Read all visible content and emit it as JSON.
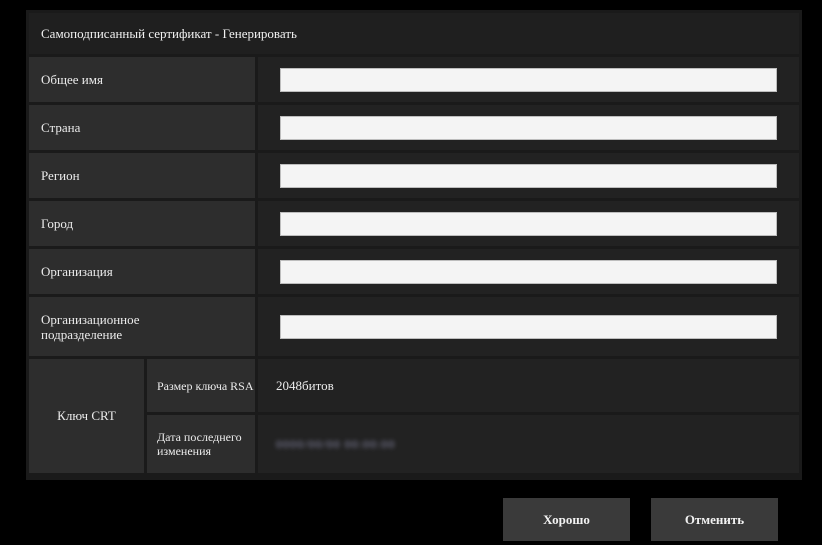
{
  "dialog": {
    "title": "Самоподписанный сертификат - Генерировать"
  },
  "fields": [
    {
      "label": "Общее имя",
      "value": ""
    },
    {
      "label": "Страна",
      "value": ""
    },
    {
      "label": "Регион",
      "value": ""
    },
    {
      "label": "Город",
      "value": ""
    },
    {
      "label": "Организация",
      "value": ""
    },
    {
      "label": "Организационное подразделение",
      "value": ""
    }
  ],
  "crt_key": {
    "label": "Ключ CRT",
    "rsa_size_label": "Размер ключа RSA",
    "rsa_size_value": "2048битов",
    "last_changed_label": "Дата последнего изменения",
    "last_changed_value": "0000/00/00 00:00:00"
  },
  "buttons": {
    "ok": "Хорошо",
    "cancel": "Отменить"
  }
}
